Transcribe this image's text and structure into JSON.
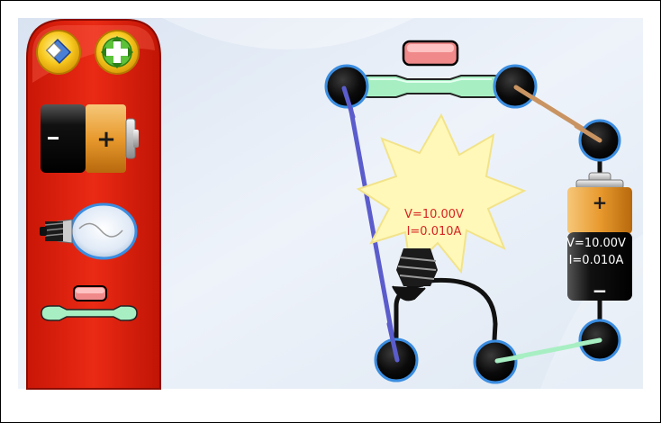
{
  "toolbar": {
    "tools": [
      {
        "name": "eraser-tool"
      },
      {
        "name": "add-node-tool"
      },
      {
        "name": "battery-tool"
      },
      {
        "name": "bulb-tool"
      },
      {
        "name": "resistor-tool"
      }
    ]
  },
  "circuit": {
    "bulb_readout": {
      "voltage": "V=10.00V",
      "current": "I=0.010A"
    },
    "battery_readout": {
      "voltage": "V=10.00V",
      "current": "I=0.010A"
    },
    "battery_plus": "+",
    "battery_minus": "−"
  },
  "colors": {
    "toolbar": "#e02413",
    "wire_blue": "#5b5ccc",
    "wire_tan": "#c99462",
    "wire_green": "#a7efc3",
    "node_ring": "#3b8de0",
    "readout_red": "#d82424",
    "readout_white": "#ffffff"
  }
}
